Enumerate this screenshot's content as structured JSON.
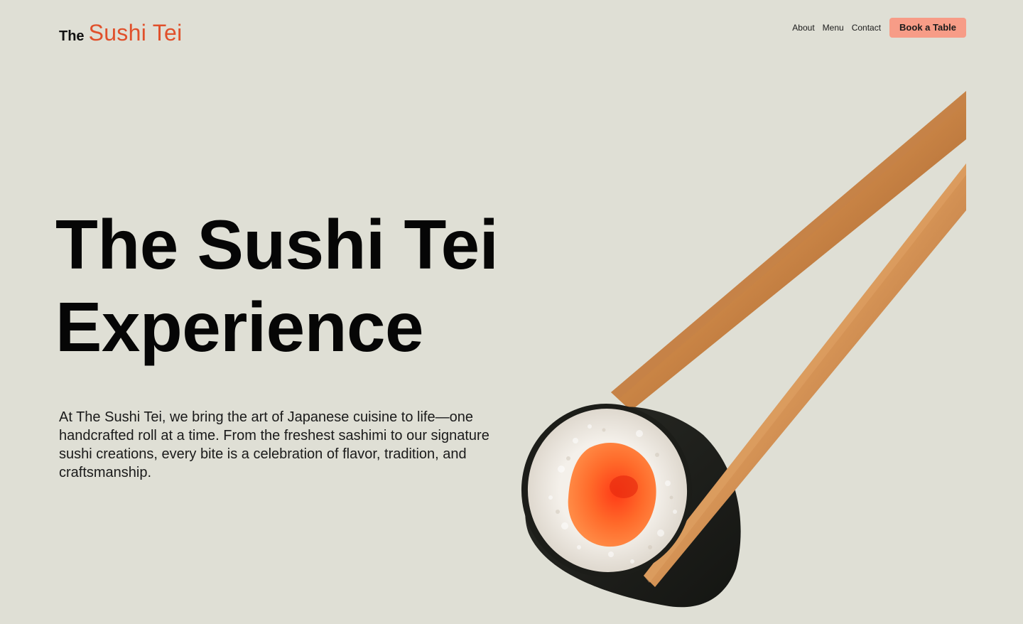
{
  "header": {
    "logo_prefix": "The",
    "logo_name": "Sushi Tei",
    "nav": [
      {
        "label": "About"
      },
      {
        "label": "Menu"
      },
      {
        "label": "Contact"
      }
    ],
    "cta_label": "Book a Table"
  },
  "hero": {
    "title_line1": "The Sushi Tei",
    "title_line2": "Experience",
    "description": "At The Sushi Tei, we bring the art of Japanese cuisine to life—one handcrafted roll at a time. From the freshest sashimi to our signature sushi creations, every bite is a celebration of flavor, tradition, and craftsmanship."
  },
  "colors": {
    "background": "#dfdfd5",
    "brand": "#e0502b",
    "cta": "#f79c87",
    "text": "#0b0b0b"
  },
  "icons": {
    "hero_image": "sushi-roll-with-chopsticks-image"
  }
}
